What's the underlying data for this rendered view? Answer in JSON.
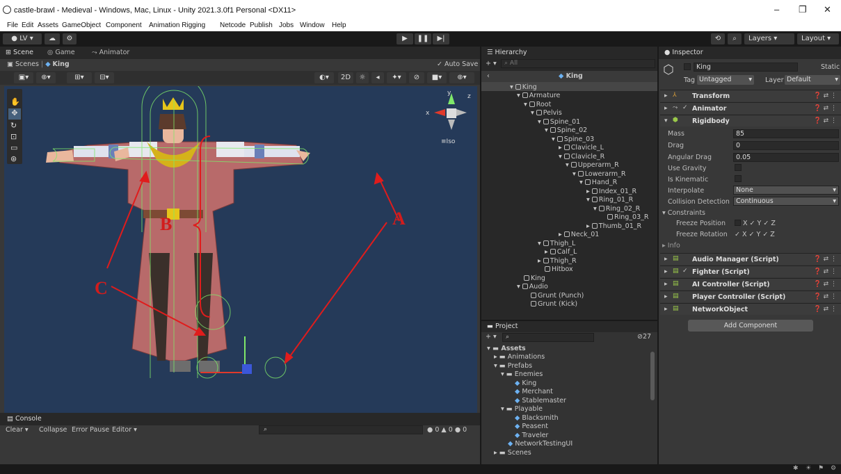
{
  "window": {
    "title": "castle-brawl - Medieval - Windows, Mac, Linux - Unity 2021.3.0f1 Personal <DX11>",
    "minimize": "–",
    "maximize": "❐",
    "close": "✕"
  },
  "menu": [
    "File",
    "Edit",
    "Assets",
    "GameObject",
    "Component",
    "Animation Rigging",
    "Netcode",
    "Publish",
    "Jobs",
    "Window",
    "Help"
  ],
  "toolbar": {
    "account": "LV ▾",
    "layers": "Layers",
    "layout": "Layout"
  },
  "scene_tabs": {
    "scene": "Scene",
    "game": "Game",
    "animator": "Animator"
  },
  "scene_bar": {
    "scenes": "Scenes",
    "current": "King",
    "autosave": "Auto Save",
    "mode2d": "2D",
    "iso": "≡Iso"
  },
  "gizmo": {
    "x": "x",
    "y": "y",
    "z": "z"
  },
  "annotations": {
    "a": "A",
    "b": "B",
    "c": "C"
  },
  "console": {
    "tab": "Console",
    "clear": "Clear",
    "collapse": "Collapse",
    "error_pause": "Error Pause",
    "editor": "Editor",
    "errors": "0",
    "warnings": "0",
    "logs": "0"
  },
  "hierarchy": {
    "tab": "Hierarchy",
    "search_placeholder": "All",
    "header": "King",
    "items": [
      {
        "label": "King"
      },
      {
        "label": "Armature"
      },
      {
        "label": "Root"
      },
      {
        "label": "Pelvis"
      },
      {
        "label": "Spine_01"
      },
      {
        "label": "Spine_02"
      },
      {
        "label": "Spine_03"
      },
      {
        "label": "Clavicle_L"
      },
      {
        "label": "Clavicle_R"
      },
      {
        "label": "Upperarm_R"
      },
      {
        "label": "Lowerarm_R"
      },
      {
        "label": "Hand_R"
      },
      {
        "label": "Index_01_R"
      },
      {
        "label": "Ring_01_R"
      },
      {
        "label": "Ring_02_R"
      },
      {
        "label": "Ring_03_R"
      },
      {
        "label": "Thumb_01_R"
      },
      {
        "label": "Neck_01"
      },
      {
        "label": "Thigh_L"
      },
      {
        "label": "Calf_L"
      },
      {
        "label": "Thigh_R"
      },
      {
        "label": "Hitbox"
      },
      {
        "label": "King"
      },
      {
        "label": "Audio"
      },
      {
        "label": "Grunt (Punch)"
      },
      {
        "label": "Grunt (Kick)"
      }
    ]
  },
  "project": {
    "tab": "Project",
    "count": "27",
    "items": [
      {
        "label": "Assets"
      },
      {
        "label": "Animations"
      },
      {
        "label": "Prefabs"
      },
      {
        "label": "Enemies"
      },
      {
        "label": "King"
      },
      {
        "label": "Merchant"
      },
      {
        "label": "Stablemaster"
      },
      {
        "label": "Playable"
      },
      {
        "label": "Blacksmith"
      },
      {
        "label": "Peasent"
      },
      {
        "label": "Traveler"
      },
      {
        "label": "NetworkTestingUI"
      },
      {
        "label": "Scenes"
      }
    ]
  },
  "inspector": {
    "tab": "Inspector",
    "name": "King",
    "static": "Static",
    "tag_label": "Tag",
    "tag": "Untagged",
    "layer_label": "Layer",
    "layer": "Default",
    "components": {
      "transform": "Transform",
      "animator": "Animator",
      "rigidbody": "Rigidbody",
      "audio_manager": "Audio Manager (Script)",
      "fighter": "Fighter (Script)",
      "ai_controller": "AI Controller (Script)",
      "player_controller": "Player Controller (Script)",
      "network_object": "NetworkObject"
    },
    "props": {
      "mass_l": "Mass",
      "mass": "85",
      "drag_l": "Drag",
      "drag": "0",
      "angdrag_l": "Angular Drag",
      "angdrag": "0.05",
      "gravity_l": "Use Gravity",
      "kinematic_l": "Is Kinematic",
      "interp_l": "Interpolate",
      "interp": "None",
      "coll_l": "Collision Detection",
      "coll": "Continuous",
      "constraints": "Constraints",
      "fpos": "Freeze Position",
      "frot": "Freeze Rotation",
      "info": "Info",
      "xyz": "X ✓ Y ✓ Z"
    },
    "add_component": "Add Component"
  }
}
